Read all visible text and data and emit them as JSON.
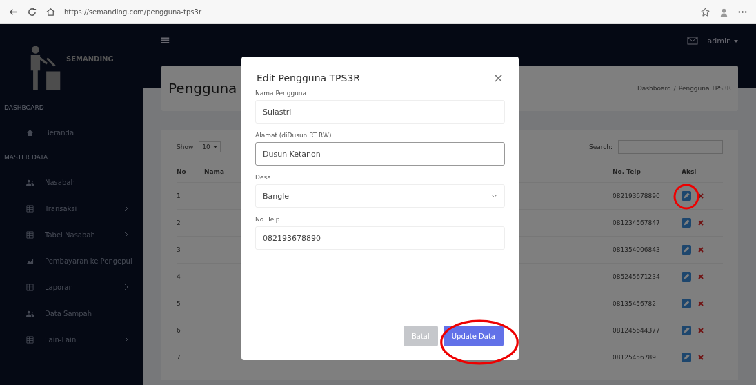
{
  "browser": {
    "url": "https://semanding.com/pengguna-tps3r"
  },
  "sidebar": {
    "logo": "SEMANDING",
    "sections": [
      {
        "heading": "DASHBOARD",
        "items": [
          {
            "label": "Beranda",
            "kind": "home",
            "has_children": false
          }
        ]
      },
      {
        "heading": "MASTER DATA",
        "items": [
          {
            "label": "Nasabah",
            "kind": "users",
            "has_children": false
          },
          {
            "label": "Transaksi",
            "kind": "table",
            "has_children": true
          },
          {
            "label": "Tabel Nasabah",
            "kind": "table",
            "has_children": true
          },
          {
            "label": "Pembayaran ke Pengepul",
            "kind": "chart",
            "has_children": false
          },
          {
            "label": "Laporan",
            "kind": "table",
            "has_children": true
          },
          {
            "label": "Data Sampah",
            "kind": "users",
            "has_children": false
          },
          {
            "label": "Lain-Lain",
            "kind": "table",
            "has_children": true
          }
        ]
      }
    ]
  },
  "topbar": {
    "menu": "≡",
    "user": "admin"
  },
  "page": {
    "title": "Pengguna",
    "breadcrumb_separator": "/",
    "breadcrumb": [
      "Dashboard",
      "Pengguna TPS3R"
    ],
    "show_label": "Show",
    "entries_value": "10",
    "search_label": "Search:",
    "table": {
      "columns": [
        "No",
        "Nama",
        "No. Telp",
        "Aksi"
      ],
      "rows": [
        {
          "no": "1",
          "phone": "082193678890"
        },
        {
          "no": "2",
          "phone": "081234567847"
        },
        {
          "no": "3",
          "phone": "081354006843"
        },
        {
          "no": "4",
          "phone": "085245671234"
        },
        {
          "no": "5",
          "phone": "08135456782"
        },
        {
          "no": "6",
          "phone": "081245644377"
        },
        {
          "no": "7",
          "phone": "08125456789"
        }
      ]
    }
  },
  "modal": {
    "title": "Edit Pengguna TPS3R",
    "close": "×",
    "fields": [
      {
        "label": "Nama Pengguna",
        "kind": "text",
        "value": "Sulastri",
        "focused": false
      },
      {
        "label": "Alamat (diDusun RT RW)",
        "kind": "text",
        "value": "Dusun Ketanon",
        "focused": true
      },
      {
        "label": "Desa",
        "kind": "select",
        "value": "Bangle",
        "focused": false
      },
      {
        "label": "No. Telp",
        "kind": "text",
        "value": "082193678890",
        "focused": false
      }
    ],
    "buttons": [
      {
        "label": "Batal",
        "kind": "secondary"
      },
      {
        "label": "Update Data",
        "kind": "primary"
      }
    ]
  }
}
